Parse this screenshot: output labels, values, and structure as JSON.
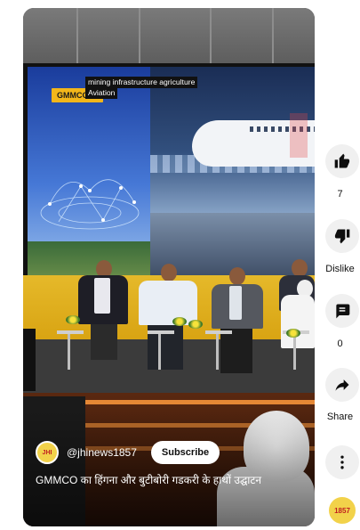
{
  "video": {
    "screen_tag_line1": "mining infrastructure agriculture",
    "screen_tag_line2": "Aviation",
    "screen_logo": "GMMCO",
    "channel_handle": "@jhinews1857",
    "subscribe_label": "Subscribe",
    "title": "GMMCO का हिंगना और बुटीबोरी गडकरी के हाथों उद्घाटन"
  },
  "rail": {
    "like_count": "7",
    "dislike_label": "Dislike",
    "comment_count": "0",
    "share_label": "Share"
  },
  "icons": {
    "like": "thumbs-up-icon",
    "dislike": "thumbs-down-icon",
    "comment": "comment-icon",
    "share": "share-arrow-icon",
    "more": "more-vertical-icon"
  },
  "colors": {
    "subscribe_bg": "#ffffff",
    "rail_button_bg": "#f0f0f0",
    "stage_yellow": "#e5b92a"
  }
}
